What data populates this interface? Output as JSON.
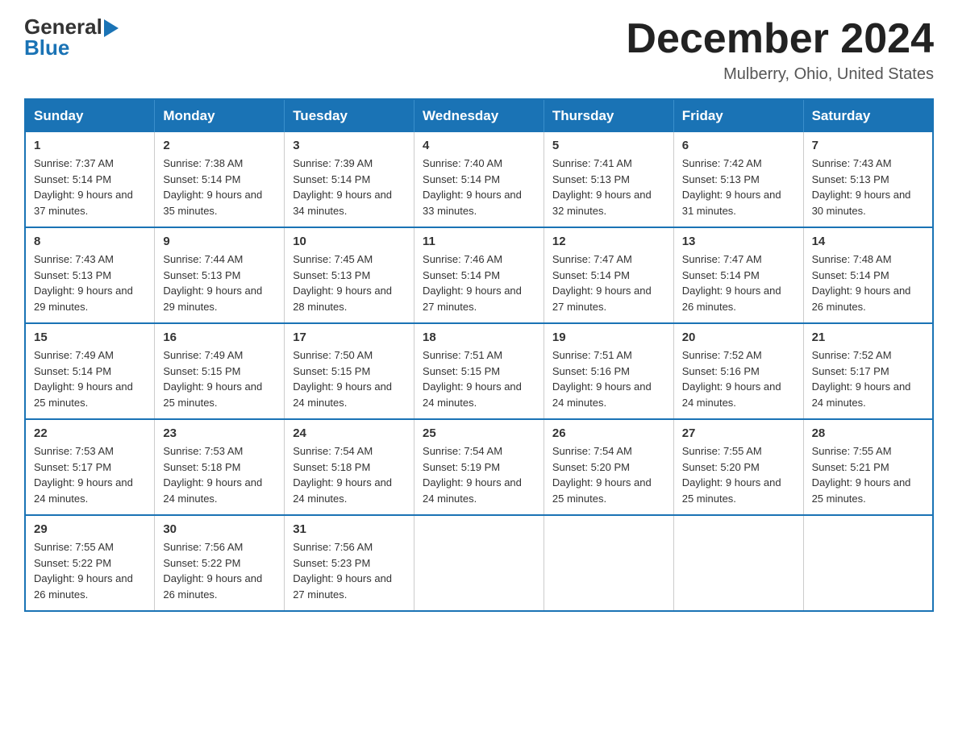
{
  "header": {
    "logo": {
      "general": "General",
      "blue": "Blue",
      "arrow_char": "▶"
    },
    "title": "December 2024",
    "location": "Mulberry, Ohio, United States"
  },
  "calendar": {
    "days_of_week": [
      "Sunday",
      "Monday",
      "Tuesday",
      "Wednesday",
      "Thursday",
      "Friday",
      "Saturday"
    ],
    "weeks": [
      [
        {
          "day": "1",
          "sunrise": "Sunrise: 7:37 AM",
          "sunset": "Sunset: 5:14 PM",
          "daylight": "Daylight: 9 hours and 37 minutes."
        },
        {
          "day": "2",
          "sunrise": "Sunrise: 7:38 AM",
          "sunset": "Sunset: 5:14 PM",
          "daylight": "Daylight: 9 hours and 35 minutes."
        },
        {
          "day": "3",
          "sunrise": "Sunrise: 7:39 AM",
          "sunset": "Sunset: 5:14 PM",
          "daylight": "Daylight: 9 hours and 34 minutes."
        },
        {
          "day": "4",
          "sunrise": "Sunrise: 7:40 AM",
          "sunset": "Sunset: 5:14 PM",
          "daylight": "Daylight: 9 hours and 33 minutes."
        },
        {
          "day": "5",
          "sunrise": "Sunrise: 7:41 AM",
          "sunset": "Sunset: 5:13 PM",
          "daylight": "Daylight: 9 hours and 32 minutes."
        },
        {
          "day": "6",
          "sunrise": "Sunrise: 7:42 AM",
          "sunset": "Sunset: 5:13 PM",
          "daylight": "Daylight: 9 hours and 31 minutes."
        },
        {
          "day": "7",
          "sunrise": "Sunrise: 7:43 AM",
          "sunset": "Sunset: 5:13 PM",
          "daylight": "Daylight: 9 hours and 30 minutes."
        }
      ],
      [
        {
          "day": "8",
          "sunrise": "Sunrise: 7:43 AM",
          "sunset": "Sunset: 5:13 PM",
          "daylight": "Daylight: 9 hours and 29 minutes."
        },
        {
          "day": "9",
          "sunrise": "Sunrise: 7:44 AM",
          "sunset": "Sunset: 5:13 PM",
          "daylight": "Daylight: 9 hours and 29 minutes."
        },
        {
          "day": "10",
          "sunrise": "Sunrise: 7:45 AM",
          "sunset": "Sunset: 5:13 PM",
          "daylight": "Daylight: 9 hours and 28 minutes."
        },
        {
          "day": "11",
          "sunrise": "Sunrise: 7:46 AM",
          "sunset": "Sunset: 5:14 PM",
          "daylight": "Daylight: 9 hours and 27 minutes."
        },
        {
          "day": "12",
          "sunrise": "Sunrise: 7:47 AM",
          "sunset": "Sunset: 5:14 PM",
          "daylight": "Daylight: 9 hours and 27 minutes."
        },
        {
          "day": "13",
          "sunrise": "Sunrise: 7:47 AM",
          "sunset": "Sunset: 5:14 PM",
          "daylight": "Daylight: 9 hours and 26 minutes."
        },
        {
          "day": "14",
          "sunrise": "Sunrise: 7:48 AM",
          "sunset": "Sunset: 5:14 PM",
          "daylight": "Daylight: 9 hours and 26 minutes."
        }
      ],
      [
        {
          "day": "15",
          "sunrise": "Sunrise: 7:49 AM",
          "sunset": "Sunset: 5:14 PM",
          "daylight": "Daylight: 9 hours and 25 minutes."
        },
        {
          "day": "16",
          "sunrise": "Sunrise: 7:49 AM",
          "sunset": "Sunset: 5:15 PM",
          "daylight": "Daylight: 9 hours and 25 minutes."
        },
        {
          "day": "17",
          "sunrise": "Sunrise: 7:50 AM",
          "sunset": "Sunset: 5:15 PM",
          "daylight": "Daylight: 9 hours and 24 minutes."
        },
        {
          "day": "18",
          "sunrise": "Sunrise: 7:51 AM",
          "sunset": "Sunset: 5:15 PM",
          "daylight": "Daylight: 9 hours and 24 minutes."
        },
        {
          "day": "19",
          "sunrise": "Sunrise: 7:51 AM",
          "sunset": "Sunset: 5:16 PM",
          "daylight": "Daylight: 9 hours and 24 minutes."
        },
        {
          "day": "20",
          "sunrise": "Sunrise: 7:52 AM",
          "sunset": "Sunset: 5:16 PM",
          "daylight": "Daylight: 9 hours and 24 minutes."
        },
        {
          "day": "21",
          "sunrise": "Sunrise: 7:52 AM",
          "sunset": "Sunset: 5:17 PM",
          "daylight": "Daylight: 9 hours and 24 minutes."
        }
      ],
      [
        {
          "day": "22",
          "sunrise": "Sunrise: 7:53 AM",
          "sunset": "Sunset: 5:17 PM",
          "daylight": "Daylight: 9 hours and 24 minutes."
        },
        {
          "day": "23",
          "sunrise": "Sunrise: 7:53 AM",
          "sunset": "Sunset: 5:18 PM",
          "daylight": "Daylight: 9 hours and 24 minutes."
        },
        {
          "day": "24",
          "sunrise": "Sunrise: 7:54 AM",
          "sunset": "Sunset: 5:18 PM",
          "daylight": "Daylight: 9 hours and 24 minutes."
        },
        {
          "day": "25",
          "sunrise": "Sunrise: 7:54 AM",
          "sunset": "Sunset: 5:19 PM",
          "daylight": "Daylight: 9 hours and 24 minutes."
        },
        {
          "day": "26",
          "sunrise": "Sunrise: 7:54 AM",
          "sunset": "Sunset: 5:20 PM",
          "daylight": "Daylight: 9 hours and 25 minutes."
        },
        {
          "day": "27",
          "sunrise": "Sunrise: 7:55 AM",
          "sunset": "Sunset: 5:20 PM",
          "daylight": "Daylight: 9 hours and 25 minutes."
        },
        {
          "day": "28",
          "sunrise": "Sunrise: 7:55 AM",
          "sunset": "Sunset: 5:21 PM",
          "daylight": "Daylight: 9 hours and 25 minutes."
        }
      ],
      [
        {
          "day": "29",
          "sunrise": "Sunrise: 7:55 AM",
          "sunset": "Sunset: 5:22 PM",
          "daylight": "Daylight: 9 hours and 26 minutes."
        },
        {
          "day": "30",
          "sunrise": "Sunrise: 7:56 AM",
          "sunset": "Sunset: 5:22 PM",
          "daylight": "Daylight: 9 hours and 26 minutes."
        },
        {
          "day": "31",
          "sunrise": "Sunrise: 7:56 AM",
          "sunset": "Sunset: 5:23 PM",
          "daylight": "Daylight: 9 hours and 27 minutes."
        },
        {
          "day": "",
          "sunrise": "",
          "sunset": "",
          "daylight": ""
        },
        {
          "day": "",
          "sunrise": "",
          "sunset": "",
          "daylight": ""
        },
        {
          "day": "",
          "sunrise": "",
          "sunset": "",
          "daylight": ""
        },
        {
          "day": "",
          "sunrise": "",
          "sunset": "",
          "daylight": ""
        }
      ]
    ]
  },
  "colors": {
    "header_bg": "#1a73b5",
    "border": "#1a73b5"
  }
}
